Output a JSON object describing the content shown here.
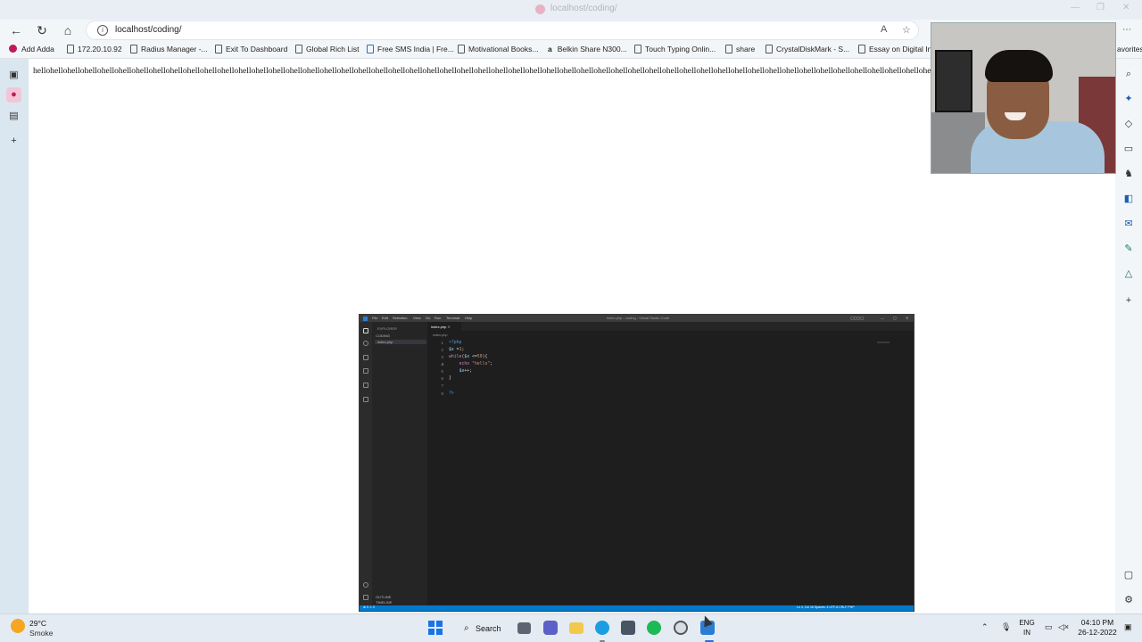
{
  "window": {
    "tab_title": "localhost/coding/"
  },
  "address_bar": {
    "url": "localhost/coding/"
  },
  "bookmarks": [
    {
      "label": "Add Adda"
    },
    {
      "label": "172.20.10.92"
    },
    {
      "label": "Radius Manager -..."
    },
    {
      "label": "Exit To Dashboard"
    },
    {
      "label": "Global Rich List"
    },
    {
      "label": "Free SMS India | Fre..."
    },
    {
      "label": "Motivational Books..."
    },
    {
      "label": "Belkin Share N300..."
    },
    {
      "label": "Touch Typing Onlin..."
    },
    {
      "label": "share"
    },
    {
      "label": "CrystalDiskMark - S..."
    },
    {
      "label": "Essay on Digital Ind"
    }
  ],
  "bookmarks_overflow": "avorites",
  "page": {
    "output_text": "hellohellohellohellohellohellohellohellohellohellohellohellohellohellohellohellohellohellohellohellohellohellohellohellohellohellohellohellohellohellohellohellohellohellohellohellohellohellohellohellohellohellohellohellohellohellohellohellohellohellohellohellohellohellohellohellohellohello"
  },
  "editor": {
    "title": "index.php - coding - Visual Studio Code",
    "menu": [
      "File",
      "Edit",
      "Selection",
      "View",
      "Go",
      "Run",
      "Terminal",
      "Help"
    ],
    "explorer_header": "EXPLORER",
    "folder": "CODING",
    "file": "index.php",
    "tab": "index.php",
    "breadcrumb": "index.php",
    "line_numbers": [
      "1",
      "2",
      "3",
      "4",
      "5",
      "6",
      "7",
      "8"
    ],
    "outline_label": "OUTLINE",
    "timeline_label": "TIMELINE",
    "status_left": "⊗ 0 ⚠ 0",
    "status_right": "Ln 4, Col 16   Spaces: 4   UTF-8   CRLF   PHP"
  },
  "taskbar": {
    "weather_temp": "29°C",
    "weather_desc": "Smoke",
    "search_label": "Search",
    "language_line1": "ENG",
    "language_line2": "IN",
    "time": "04:10 PM",
    "date": "26-12-2022"
  },
  "colors": {
    "page_bg": "#ffffff",
    "chrome_bg": "#dbe7f0",
    "editor_bg": "#1e1e1e",
    "editor_status": "#007acc",
    "start_blue": "#1a73e8"
  }
}
